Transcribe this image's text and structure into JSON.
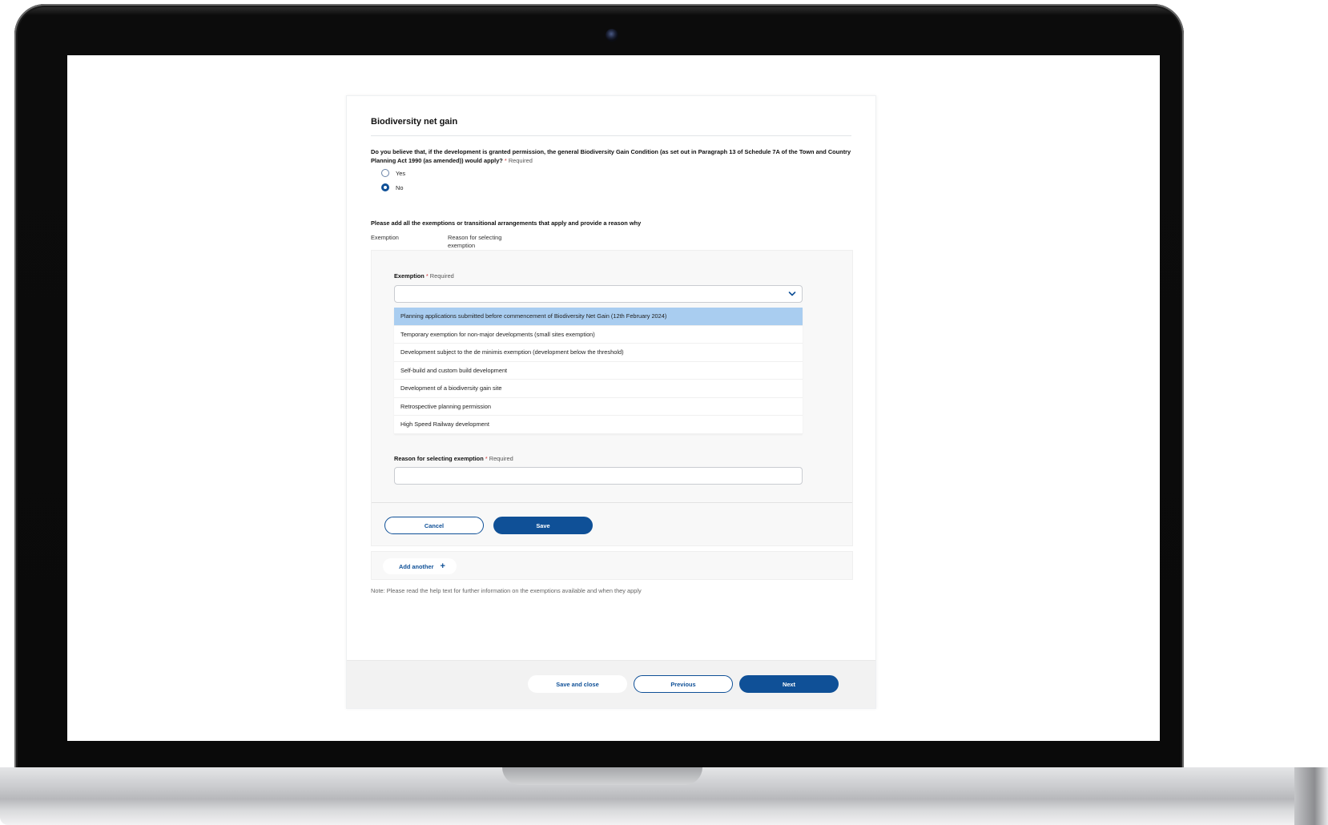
{
  "form": {
    "title": "Biodiversity net gain",
    "question": "Do you believe that, if the development is granted permission, the general Biodiversity Gain Condition (as set out in Paragraph 13 of Schedule 7A of the Town and Country Planning Act 1990 (as amended)) would apply?",
    "required_star": "*",
    "required_text": "Required",
    "radio_options": [
      {
        "label": "Yes",
        "checked": false
      },
      {
        "label": "No",
        "checked": true
      }
    ],
    "exemptions_prompt": "Please add all the exemptions or transitional arrangements that apply and provide a reason why",
    "columns": [
      "Exemption",
      "Reason for selecting exemption"
    ],
    "exemption_label": "Exemption",
    "exemption_value": "",
    "exemption_options": [
      "Planning applications submitted before commencement of Biodiversity Net Gain (12th February 2024)",
      "Temporary exemption for non-major developments (small sites exemption)",
      "Development subject to the de minimis exemption (development below the threshold)",
      "Self-build and custom build development",
      "Development of a biodiversity gain site",
      "Retrospective planning permission",
      "High Speed Railway development"
    ],
    "highlighted_option": "Planning applications submitted before commencement of Biodiversity Net Gain (12th February 2024)",
    "reason_label": "Reason for selecting exemption",
    "reason_value": "",
    "cancel_label": "Cancel",
    "save_label": "Save",
    "add_another_label": "Add another",
    "note": "Note: Please read the help text for further information on the exemptions available and when they apply"
  },
  "footer": {
    "save_close_label": "Save and close",
    "previous_label": "Previous",
    "next_label": "Next"
  },
  "icons": {
    "dropdown": "chevron-down-icon",
    "add": "plus-icon"
  },
  "colors": {
    "primary": "#0f5097",
    "highlight": "#a9cdf0",
    "required": "#d13438"
  }
}
